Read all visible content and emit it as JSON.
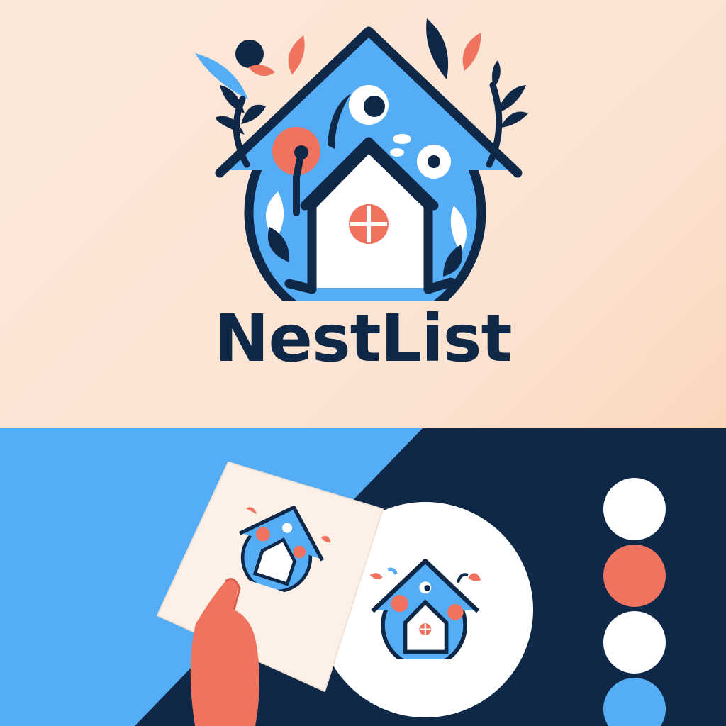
{
  "brand": {
    "name": "NestList"
  },
  "palette": {
    "navy": "#0f2847",
    "blue": "#55adf5",
    "coral": "#f0735f",
    "cream": "#fbe6d6",
    "white": "#ffffff"
  },
  "swatches": [
    {
      "color": "#ffffff"
    },
    {
      "color": "#f0735f"
    },
    {
      "color": "#ffffff"
    },
    {
      "color": "#55adf5"
    }
  ],
  "icons": {
    "main_logo": "house-leaves-logo",
    "card_logo": "house-leaves-logo",
    "circle_logo": "house-leaves-logo",
    "hand": "hand-icon"
  }
}
